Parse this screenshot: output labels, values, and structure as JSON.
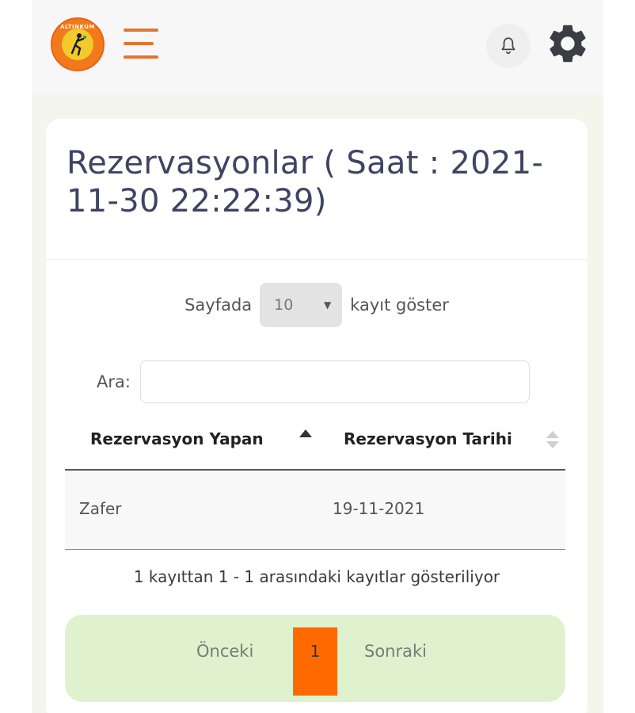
{
  "header": {
    "logo_text": "ALTINKUM",
    "notification_icon": "bell-icon",
    "settings_icon": "gear-icon",
    "menu_icon": "hamburger-icon",
    "accent_color": "#e2752f"
  },
  "page": {
    "title": "Rezervasyonlar ( Saat : 2021-11-30 22:22:39)"
  },
  "table_controls": {
    "length_prefix": "Sayfada",
    "length_value": "10",
    "length_suffix": "kayıt göster",
    "search_label": "Ara:",
    "search_value": ""
  },
  "table": {
    "columns": [
      "Rezervasyon Yapan",
      "Rezervasyon Tarihi"
    ],
    "rows": [
      [
        "Zafer",
        "19-11-2021"
      ]
    ],
    "info": "1 kayıttan 1 - 1 arasındaki kayıtlar gösteriliyor"
  },
  "pagination": {
    "previous": "Önceki",
    "current": "1",
    "next": "Sonraki",
    "active_color": "#ff6a00"
  }
}
